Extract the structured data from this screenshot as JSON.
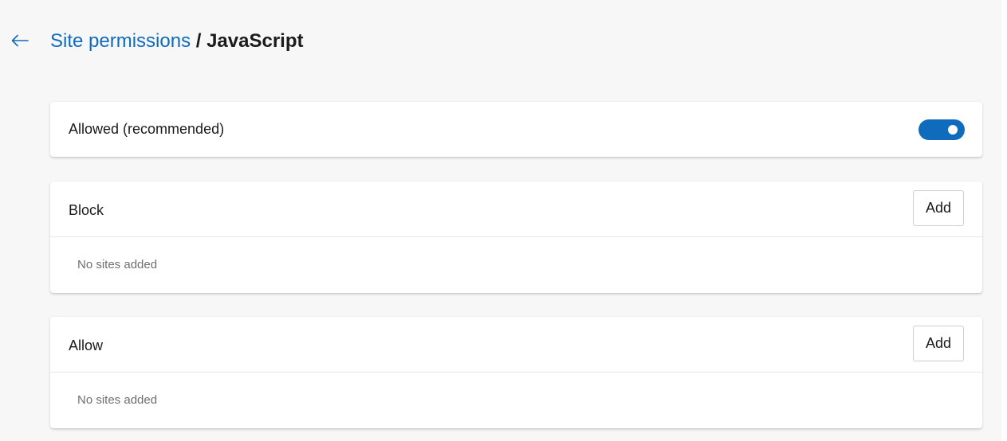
{
  "header": {
    "breadcrumb_link": "Site permissions",
    "separator": " / ",
    "current": "JavaScript"
  },
  "toggle_row": {
    "label": "Allowed (recommended)",
    "state": "on"
  },
  "block_section": {
    "title": "Block",
    "add_label": "Add",
    "empty_text": "No sites added"
  },
  "allow_section": {
    "title": "Allow",
    "add_label": "Add",
    "empty_text": "No sites added"
  },
  "icons": {
    "back": "back-arrow-icon"
  },
  "colors": {
    "accent": "#0f6cbd",
    "background": "#f7f7f7",
    "card": "#ffffff",
    "muted_text": "#6e6e6e"
  }
}
